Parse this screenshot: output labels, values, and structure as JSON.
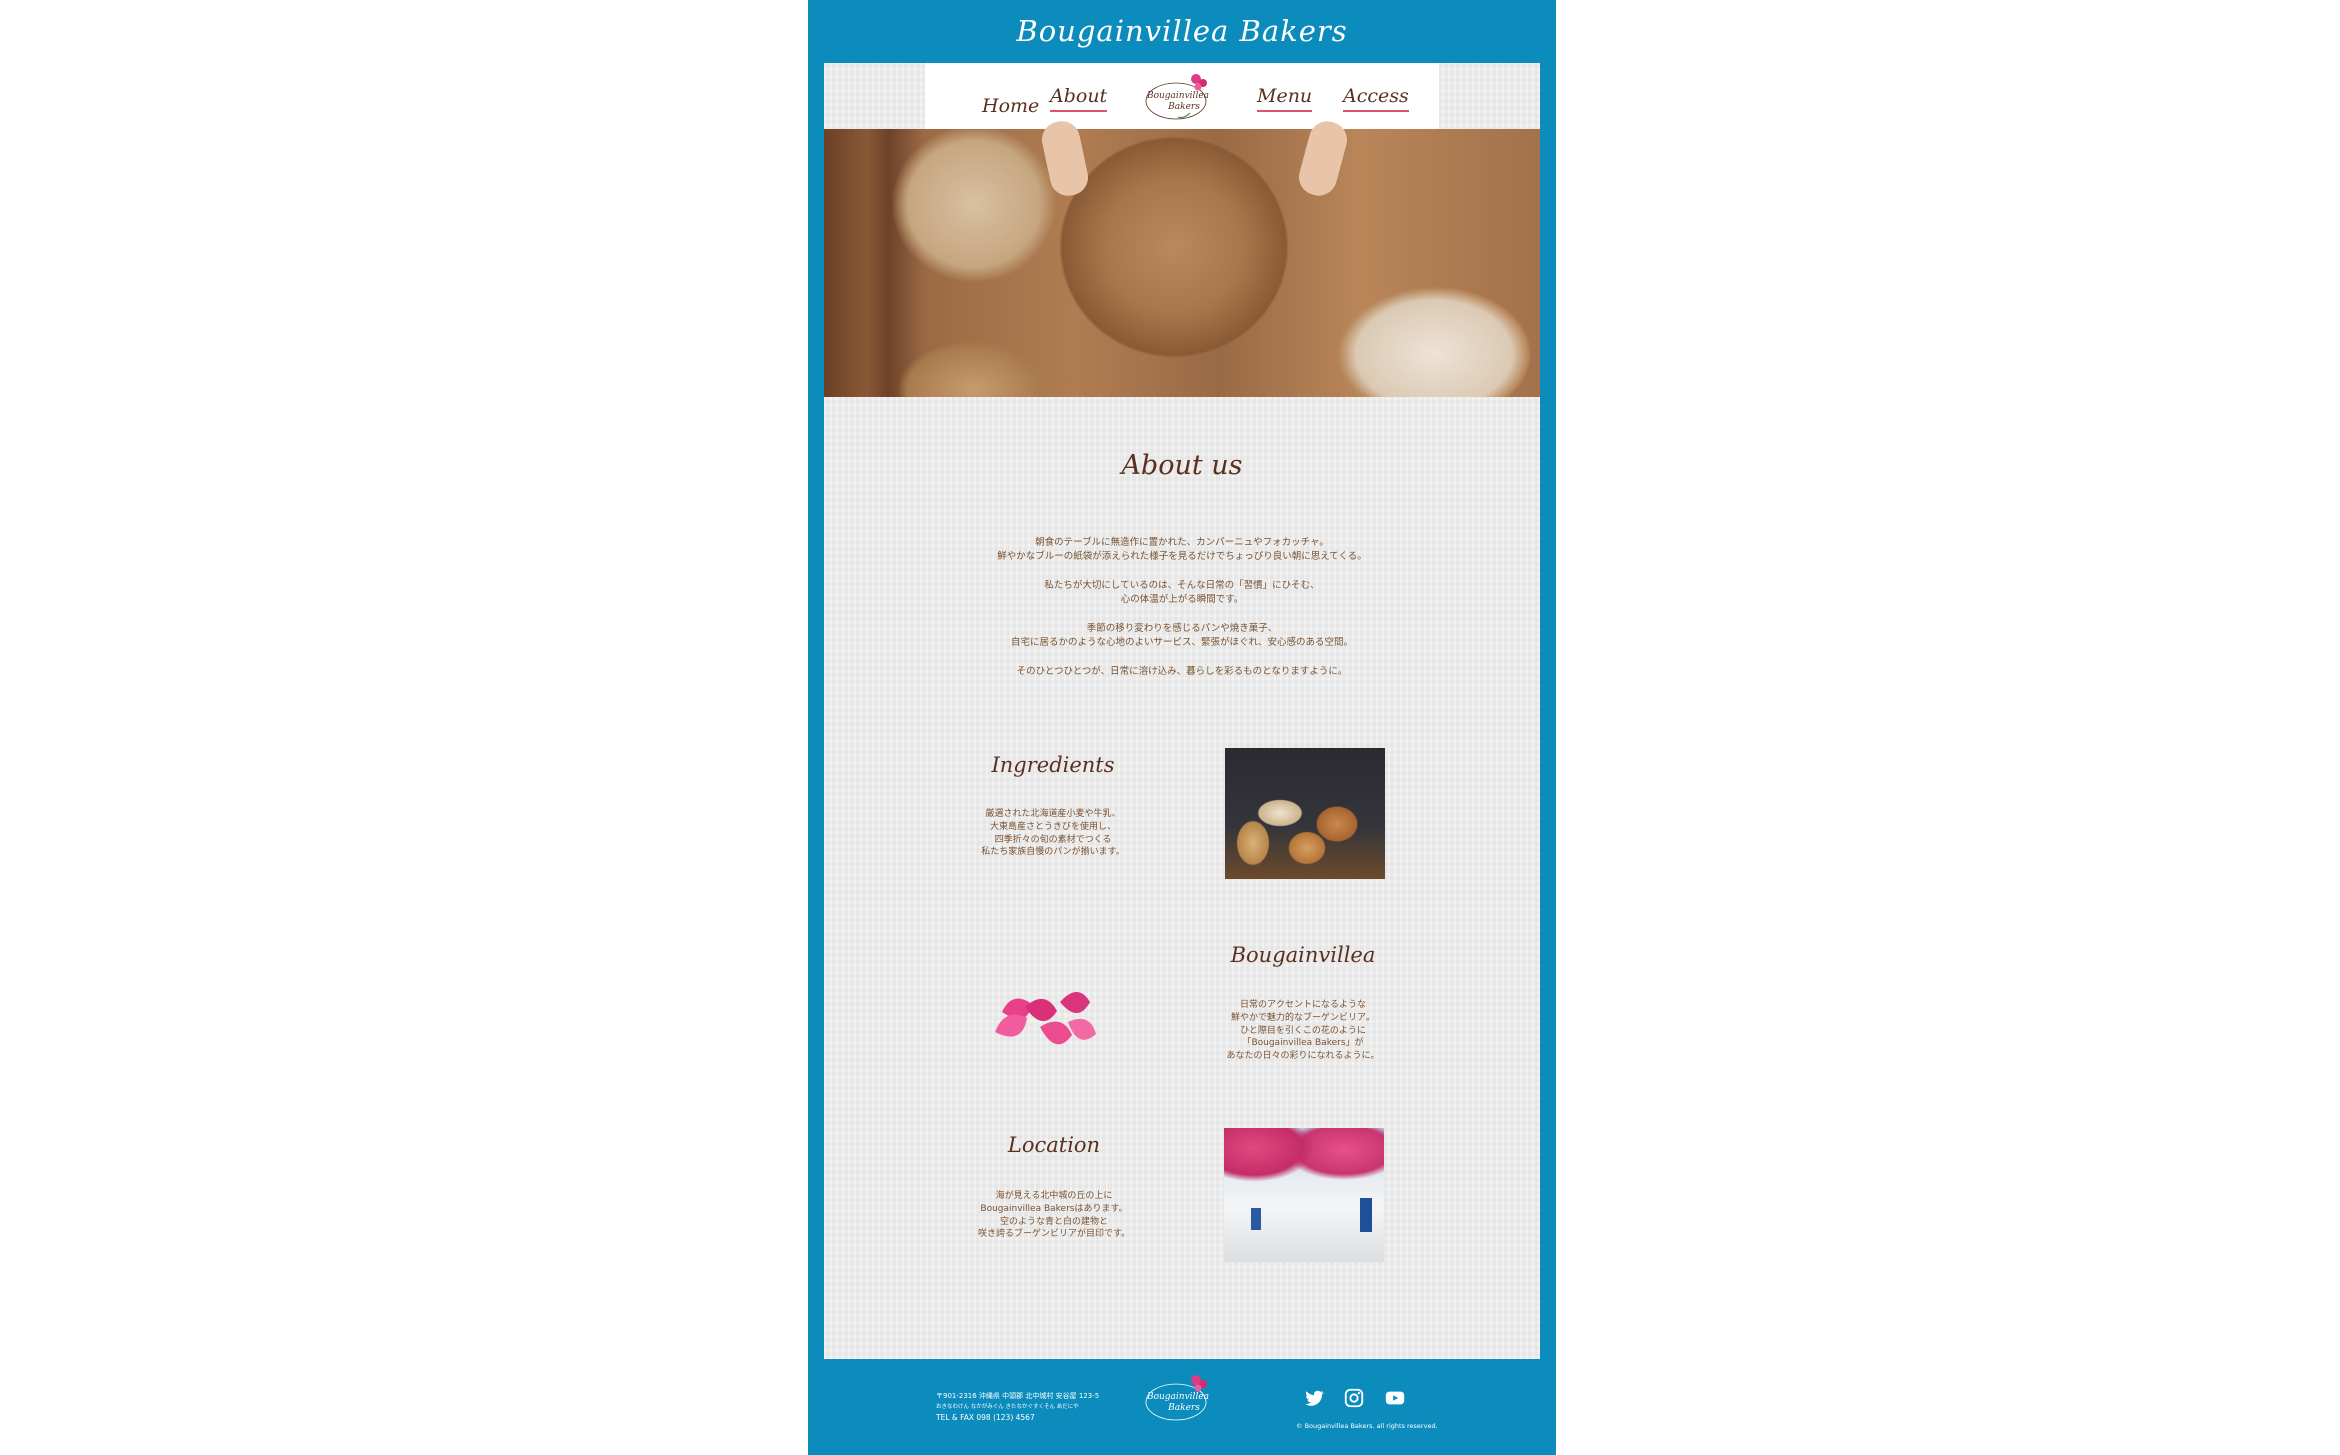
{
  "site": {
    "title": "Bougainvillea Bakers"
  },
  "nav": {
    "items": [
      {
        "label": "Home"
      },
      {
        "label": "About"
      },
      {
        "label": "Menu"
      },
      {
        "label": "Access"
      }
    ],
    "logo_line1": "Bougainvillea",
    "logo_line2": "Bakers"
  },
  "about": {
    "title": "About us",
    "paragraphs": [
      [
        "朝食のテーブルに無造作に置かれた、カンパーニュやフォカッチャ。",
        "鮮やかなブルーの紙袋が添えられた様子を見るだけでちょっぴり良い朝に思えてくる。"
      ],
      [
        "私たちが大切にしているのは、そんな日常の「習慣」にひそむ、",
        "心の体温が上がる瞬間です。"
      ],
      [
        "季節の移り変わりを感じるパンや焼き菓子、",
        "自宅に居るかのような心地のよいサービス、緊張がほぐれ、安心感のある空間。"
      ],
      [
        "そのひとつひとつが、日常に溶け込み、暮らしを彩るものとなりますように。"
      ]
    ]
  },
  "ingredients": {
    "title": "Ingredients",
    "text": "厳選された北海道産小麦や牛乳、\n大東島産さとうきびを使用し、\n四季折々の旬の素材でつくる\n私たち家族自慢のパンが揃います。"
  },
  "bougainvillea": {
    "title": "Bougainvillea",
    "text": "日常のアクセントになるような\n鮮やかで魅力的なブーゲンビリア。\nひと際目を引くこの花のように\n「Bougainvillea Bakers」が\nあなたの日々の彩りになれるように。"
  },
  "location": {
    "title": "Location",
    "text": "海が見える北中城の丘の上に\nBougainvillea Bakersはあります。\n空のような青と白の建物と\n咲き誇るブーゲンビリアが目印です。"
  },
  "footer": {
    "address_line1": "〒901-2316 沖縄県 中頭郡 北中城村 安谷屋 123-5",
    "address_line2": "おきなわけん なかがみぐん きたなかぐすくそん あだにや",
    "tel": "TEL & FAX 098 (123) 4567",
    "copyright": "© Bougainvillea Bakers. all rights reserved.",
    "social": [
      "twitter-icon",
      "instagram-icon",
      "youtube-icon"
    ]
  },
  "colors": {
    "frame": "#0b8cbd",
    "accent": "#d9556d",
    "text_brown": "#5a3020",
    "paper": "#ececec"
  }
}
